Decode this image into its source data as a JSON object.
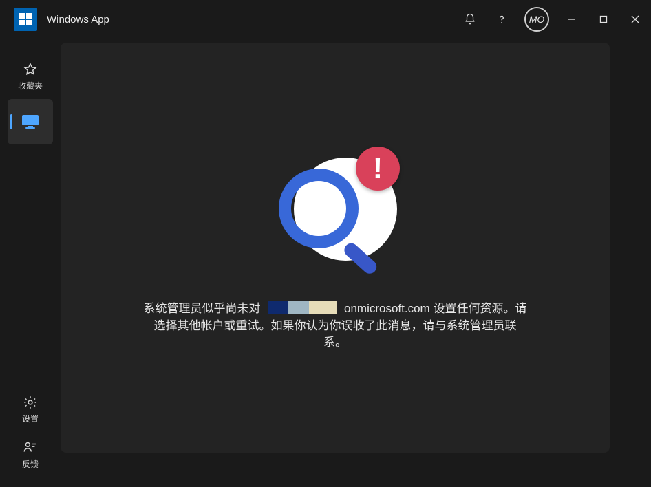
{
  "titlebar": {
    "app_name": "Windows App",
    "avatar_initials": "MO"
  },
  "sidebar": {
    "favorites_label": "收藏夹",
    "settings_label": "设置",
    "feedback_label": "反馈"
  },
  "message": {
    "part1": "系统管理员似乎尚未对",
    "domain_suffix": "onmicrosoft.com 设置任何资源。请选择其他帐户或重试。如果你认为你误收了此消息，请与系统管理员联系。"
  },
  "icons": {
    "bell": "bell-icon",
    "help": "help-icon",
    "min": "minimize-icon",
    "max": "maximize-icon",
    "close": "close-icon",
    "star": "star-icon",
    "monitor": "monitor-icon",
    "gear": "gear-icon",
    "feedback": "feedback-icon",
    "search_error": "search-error-illustration"
  }
}
